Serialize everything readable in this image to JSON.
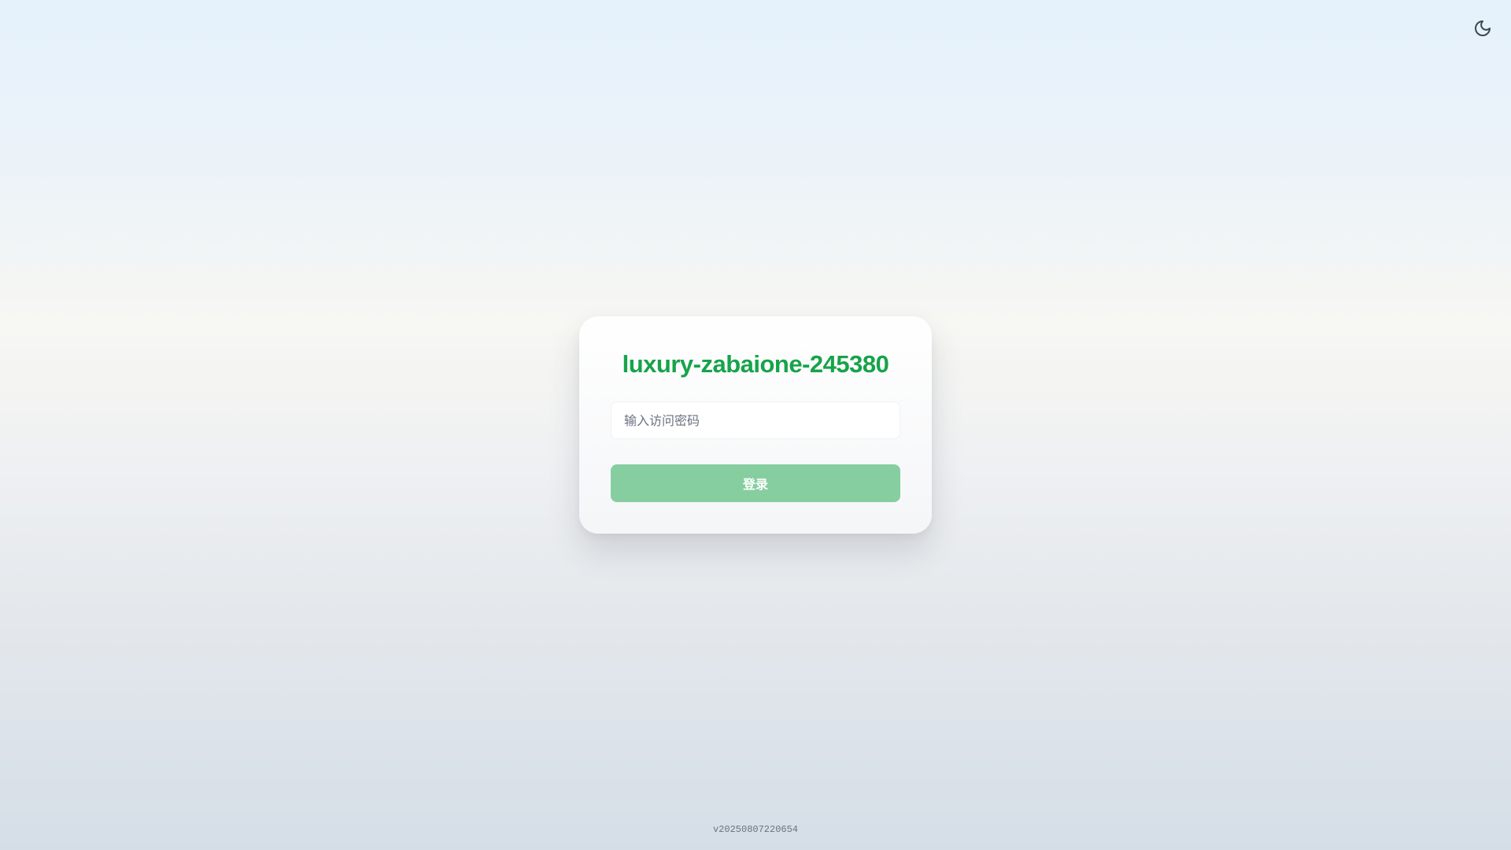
{
  "header": {
    "theme_toggle_icon": "moon-icon"
  },
  "login": {
    "title": "luxury-zabaione-245380",
    "password_placeholder": "输入访问密码",
    "password_value": "",
    "submit_label": "登录"
  },
  "footer": {
    "version": "v20250807220654"
  },
  "colors": {
    "title": "#17a34a",
    "button_bg": "#86cea0",
    "button_text": "#ffffff",
    "icon": "#3f4650"
  }
}
